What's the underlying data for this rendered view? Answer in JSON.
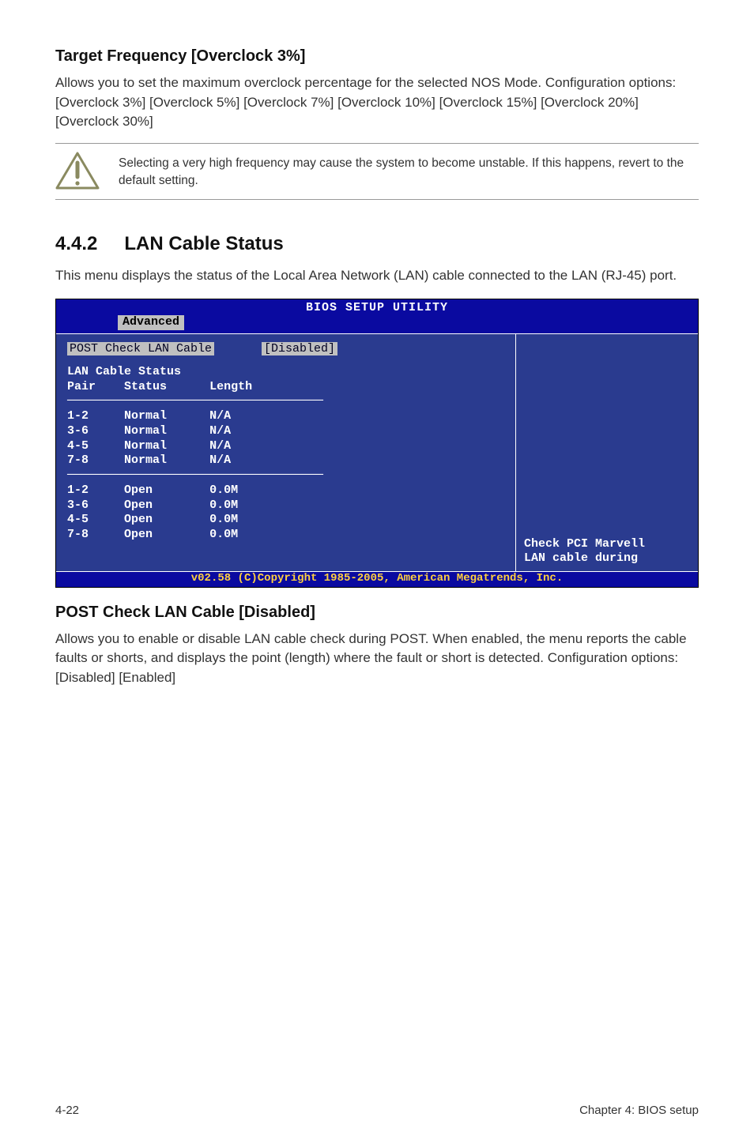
{
  "section1": {
    "title": "Target Frequency [Overclock 3%]",
    "body": "Allows you to set the maximum overclock percentage for the selected NOS Mode. Configuration options: [Overclock 3%] [Overclock 5%] [Overclock 7%] [Overclock 10%] [Overclock 15%] [Overclock 20%] [Overclock 30%]"
  },
  "note": {
    "text": "Selecting a very high frequency may cause the system to become unstable. If this happens, revert to the default setting."
  },
  "section2": {
    "number": "4.4.2",
    "title": "LAN Cable Status",
    "intro": "This menu displays the status of the Local Area Network (LAN) cable connected to the LAN (RJ-45) port."
  },
  "bios": {
    "title": "BIOS SETUP UTILITY",
    "tab": "Advanced",
    "field_label": "POST Check LAN Cable",
    "field_value": "[Disabled]",
    "status_header": "LAN Cable Status",
    "col_pair": "Pair",
    "col_status": "Status",
    "col_length": "Length",
    "rows_a": [
      {
        "pair": "1-2",
        "status": "Normal",
        "length": "N/A"
      },
      {
        "pair": "3-6",
        "status": "Normal",
        "length": "N/A"
      },
      {
        "pair": "4-5",
        "status": "Normal",
        "length": "N/A"
      },
      {
        "pair": "7-8",
        "status": "Normal",
        "length": "N/A"
      }
    ],
    "rows_b": [
      {
        "pair": "1-2",
        "status": "Open",
        "length": "0.0M"
      },
      {
        "pair": "3-6",
        "status": "Open",
        "length": "0.0M"
      },
      {
        "pair": "4-5",
        "status": "Open",
        "length": "0.0M"
      },
      {
        "pair": "7-8",
        "status": "Open",
        "length": "0.0M"
      }
    ],
    "help1": "Check PCI Marvell",
    "help2": "LAN cable during",
    "footer": "v02.58 (C)Copyright 1985-2005, American Megatrends, Inc."
  },
  "section3": {
    "title": "POST Check LAN Cable [Disabled]",
    "body": "Allows you to enable or disable LAN cable check during POST. When enabled, the menu reports the cable faults or shorts, and displays the point (length) where the fault or short is detected. Configuration options: [Disabled] [Enabled]"
  },
  "footer": {
    "left": "4-22",
    "right": "Chapter 4: BIOS setup"
  }
}
